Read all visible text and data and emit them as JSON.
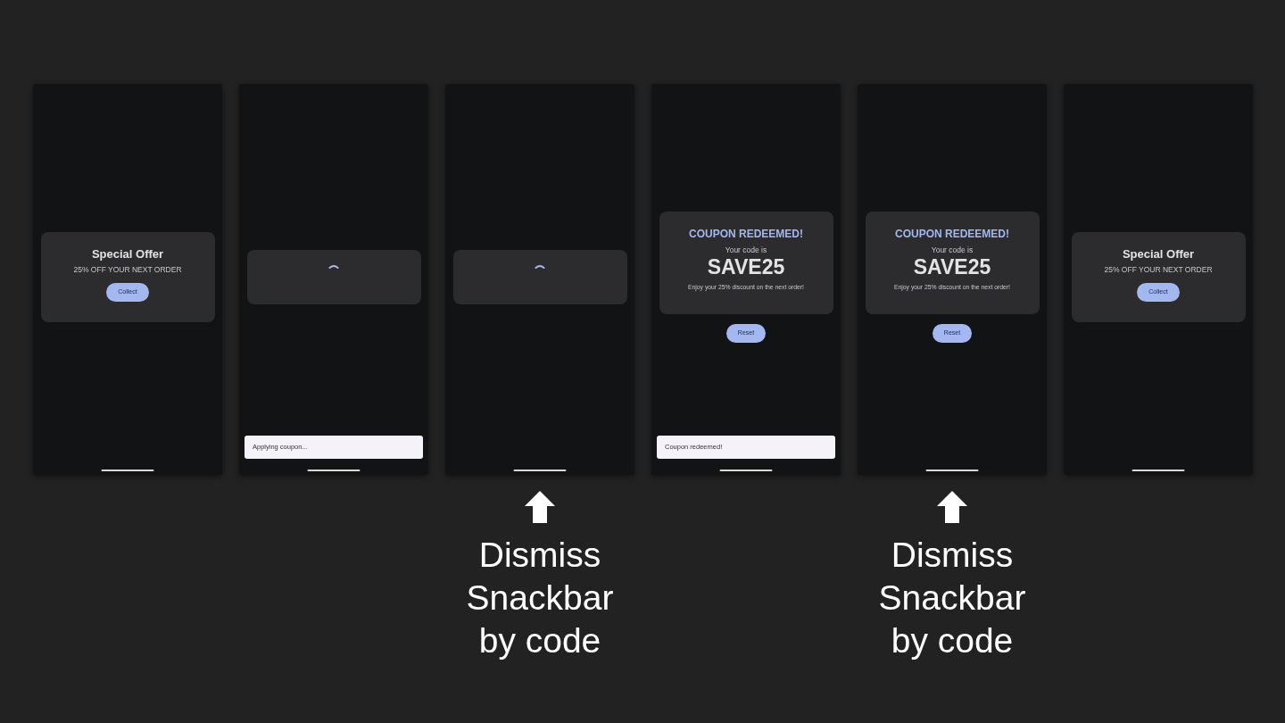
{
  "phones": [
    {
      "kind": "offer",
      "title": "Special Offer",
      "subtitle": "25% OFF YOUR NEXT ORDER",
      "button": "Collect"
    },
    {
      "kind": "loading",
      "snackbar": "Applying coupon..."
    },
    {
      "kind": "loading",
      "caption": "Dismiss\nSnackbar\nby code"
    },
    {
      "kind": "redeemed",
      "title": "COUPON REDEEMED!",
      "lead": "Your code is",
      "code": "SAVE25",
      "note": "Enjoy your 25% discount on the next order!",
      "button": "Reset",
      "snackbar": "Coupon redeemed!"
    },
    {
      "kind": "redeemed",
      "title": "COUPON REDEEMED!",
      "lead": "Your code is",
      "code": "SAVE25",
      "note": "Enjoy your 25% discount on the next order!",
      "button": "Reset",
      "caption": "Dismiss\nSnackbar\nby code"
    },
    {
      "kind": "offer",
      "title": "Special Offer",
      "subtitle": "25% OFF YOUR NEXT ORDER",
      "button": "Collect"
    }
  ]
}
